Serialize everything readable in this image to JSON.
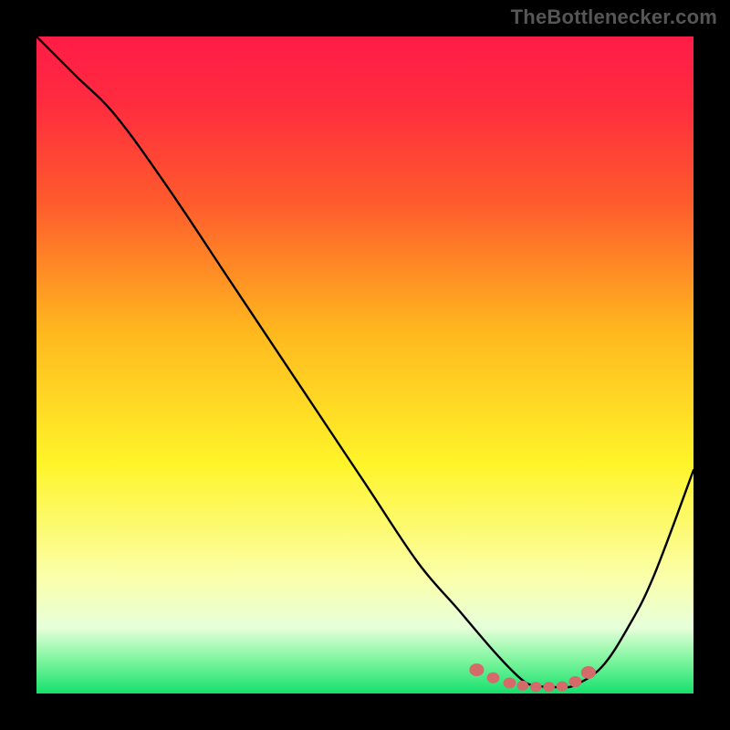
{
  "watermark": "TheBottlenecker.com",
  "chart_data": {
    "type": "line",
    "title": "",
    "xlabel": "",
    "ylabel": "",
    "xlim": [
      0,
      100
    ],
    "ylim": [
      0,
      100
    ],
    "grid": false,
    "legend": false,
    "series": [
      {
        "name": "curve",
        "color": "#000000",
        "x": [
          0,
          6,
          12,
          20,
          30,
          40,
          50,
          58,
          64,
          70,
          74,
          76,
          78,
          80,
          82,
          86,
          90,
          94,
          100
        ],
        "values": [
          100,
          94,
          88,
          77,
          62,
          47,
          32,
          20,
          13,
          6,
          2,
          1.2,
          1,
          1,
          1.3,
          4,
          10,
          18,
          34
        ]
      }
    ],
    "markers": {
      "name": "optimal-range",
      "color": "#d46a6a",
      "x": [
        67,
        69.5,
        72,
        74,
        76,
        78,
        80,
        82,
        84
      ],
      "values": [
        3.6,
        2.4,
        1.6,
        1.2,
        1.0,
        1.0,
        1.1,
        1.8,
        3.2
      ],
      "radius": [
        7,
        6,
        6,
        5.5,
        5.5,
        5.5,
        5.5,
        6,
        7
      ]
    },
    "gradient": {
      "stops": [
        {
          "offset": 0.0,
          "color": "#ff1c47"
        },
        {
          "offset": 0.1,
          "color": "#ff2b3f"
        },
        {
          "offset": 0.25,
          "color": "#ff5a2d"
        },
        {
          "offset": 0.45,
          "color": "#ffb81e"
        },
        {
          "offset": 0.65,
          "color": "#fff429"
        },
        {
          "offset": 0.82,
          "color": "#fbffa8"
        },
        {
          "offset": 0.9,
          "color": "#e6ffda"
        },
        {
          "offset": 0.95,
          "color": "#7cf59d"
        },
        {
          "offset": 1.0,
          "color": "#15e06e"
        }
      ]
    }
  }
}
